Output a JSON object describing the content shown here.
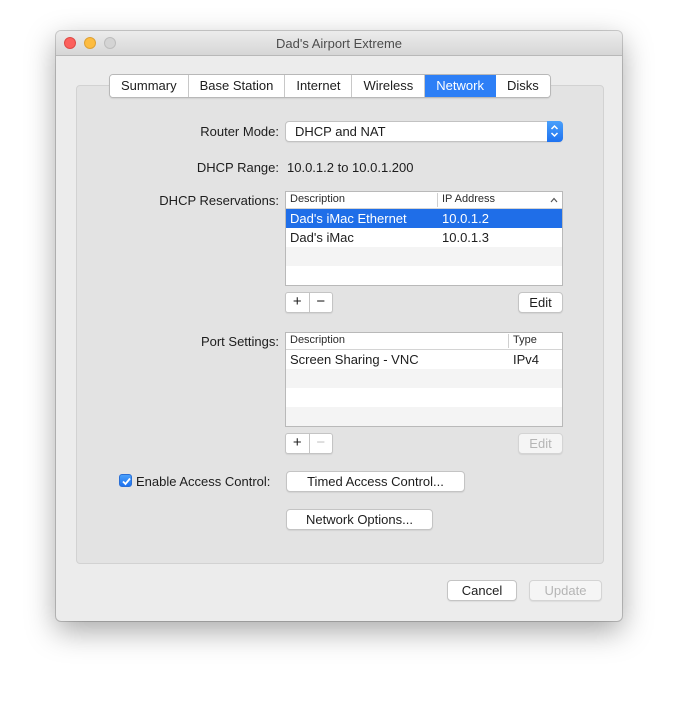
{
  "window": {
    "title": "Dad's Airport Extreme"
  },
  "tabs": [
    "Summary",
    "Base Station",
    "Internet",
    "Wireless",
    "Network",
    "Disks"
  ],
  "active_tab": "Network",
  "router_mode": {
    "label": "Router Mode:",
    "value": "DHCP and NAT"
  },
  "dhcp_range": {
    "label": "DHCP Range:",
    "value": "10.0.1.2 to 10.0.1.200"
  },
  "dhcp_reservations": {
    "label": "DHCP Reservations:",
    "columns": [
      "Description",
      "IP Address"
    ],
    "rows": [
      {
        "description": "Dad's iMac Ethernet",
        "ip": "10.0.1.2",
        "selected": true
      },
      {
        "description": "Dad's iMac",
        "ip": "10.0.1.3",
        "selected": false
      }
    ],
    "add": "+",
    "remove": "−",
    "edit": "Edit"
  },
  "port_settings": {
    "label": "Port Settings:",
    "columns": [
      "Description",
      "Type"
    ],
    "rows": [
      {
        "description": "Screen Sharing - VNC",
        "type": "IPv4"
      }
    ],
    "add": "+",
    "remove": "−",
    "edit": "Edit"
  },
  "access_control": {
    "label": "Enable Access Control:",
    "checked": true,
    "button": "Timed Access Control..."
  },
  "network_options": "Network Options...",
  "footer": {
    "cancel": "Cancel",
    "update": "Update"
  },
  "colors": {
    "accent": "#2d7ff6",
    "selection": "#1f6ee8",
    "window_bg": "#ececec"
  }
}
